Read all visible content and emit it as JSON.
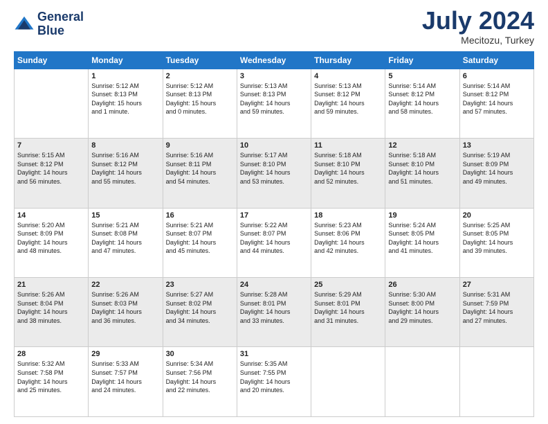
{
  "header": {
    "logo_line1": "General",
    "logo_line2": "Blue",
    "month": "July 2024",
    "location": "Mecitozu, Turkey"
  },
  "weekdays": [
    "Sunday",
    "Monday",
    "Tuesday",
    "Wednesday",
    "Thursday",
    "Friday",
    "Saturday"
  ],
  "weeks": [
    [
      {
        "day": "",
        "info": ""
      },
      {
        "day": "1",
        "info": "Sunrise: 5:12 AM\nSunset: 8:13 PM\nDaylight: 15 hours\nand 1 minute."
      },
      {
        "day": "2",
        "info": "Sunrise: 5:12 AM\nSunset: 8:13 PM\nDaylight: 15 hours\nand 0 minutes."
      },
      {
        "day": "3",
        "info": "Sunrise: 5:13 AM\nSunset: 8:13 PM\nDaylight: 14 hours\nand 59 minutes."
      },
      {
        "day": "4",
        "info": "Sunrise: 5:13 AM\nSunset: 8:12 PM\nDaylight: 14 hours\nand 59 minutes."
      },
      {
        "day": "5",
        "info": "Sunrise: 5:14 AM\nSunset: 8:12 PM\nDaylight: 14 hours\nand 58 minutes."
      },
      {
        "day": "6",
        "info": "Sunrise: 5:14 AM\nSunset: 8:12 PM\nDaylight: 14 hours\nand 57 minutes."
      }
    ],
    [
      {
        "day": "7",
        "info": ""
      },
      {
        "day": "8",
        "info": "Sunrise: 5:16 AM\nSunset: 8:12 PM\nDaylight: 14 hours\nand 55 minutes."
      },
      {
        "day": "9",
        "info": "Sunrise: 5:16 AM\nSunset: 8:11 PM\nDaylight: 14 hours\nand 54 minutes."
      },
      {
        "day": "10",
        "info": "Sunrise: 5:17 AM\nSunset: 8:10 PM\nDaylight: 14 hours\nand 53 minutes."
      },
      {
        "day": "11",
        "info": "Sunrise: 5:18 AM\nSunset: 8:10 PM\nDaylight: 14 hours\nand 52 minutes."
      },
      {
        "day": "12",
        "info": "Sunrise: 5:18 AM\nSunset: 8:10 PM\nDaylight: 14 hours\nand 51 minutes."
      },
      {
        "day": "13",
        "info": "Sunrise: 5:19 AM\nSunset: 8:09 PM\nDaylight: 14 hours\nand 49 minutes."
      }
    ],
    [
      {
        "day": "14",
        "info": ""
      },
      {
        "day": "15",
        "info": "Sunrise: 5:21 AM\nSunset: 8:08 PM\nDaylight: 14 hours\nand 47 minutes."
      },
      {
        "day": "16",
        "info": "Sunrise: 5:21 AM\nSunset: 8:07 PM\nDaylight: 14 hours\nand 45 minutes."
      },
      {
        "day": "17",
        "info": "Sunrise: 5:22 AM\nSunset: 8:07 PM\nDaylight: 14 hours\nand 44 minutes."
      },
      {
        "day": "18",
        "info": "Sunrise: 5:23 AM\nSunset: 8:06 PM\nDaylight: 14 hours\nand 42 minutes."
      },
      {
        "day": "19",
        "info": "Sunrise: 5:24 AM\nSunset: 8:05 PM\nDaylight: 14 hours\nand 41 minutes."
      },
      {
        "day": "20",
        "info": "Sunrise: 5:25 AM\nSunset: 8:05 PM\nDaylight: 14 hours\nand 39 minutes."
      }
    ],
    [
      {
        "day": "21",
        "info": ""
      },
      {
        "day": "22",
        "info": "Sunrise: 5:26 AM\nSunset: 8:03 PM\nDaylight: 14 hours\nand 36 minutes."
      },
      {
        "day": "23",
        "info": "Sunrise: 5:27 AM\nSunset: 8:02 PM\nDaylight: 14 hours\nand 34 minutes."
      },
      {
        "day": "24",
        "info": "Sunrise: 5:28 AM\nSunset: 8:01 PM\nDaylight: 14 hours\nand 33 minutes."
      },
      {
        "day": "25",
        "info": "Sunrise: 5:29 AM\nSunset: 8:01 PM\nDaylight: 14 hours\nand 31 minutes."
      },
      {
        "day": "26",
        "info": "Sunrise: 5:30 AM\nSunset: 8:00 PM\nDaylight: 14 hours\nand 29 minutes."
      },
      {
        "day": "27",
        "info": "Sunrise: 5:31 AM\nSunset: 7:59 PM\nDaylight: 14 hours\nand 27 minutes."
      }
    ],
    [
      {
        "day": "28",
        "info": "Sunrise: 5:32 AM\nSunset: 7:58 PM\nDaylight: 14 hours\nand 25 minutes."
      },
      {
        "day": "29",
        "info": "Sunrise: 5:33 AM\nSunset: 7:57 PM\nDaylight: 14 hours\nand 24 minutes."
      },
      {
        "day": "30",
        "info": "Sunrise: 5:34 AM\nSunset: 7:56 PM\nDaylight: 14 hours\nand 22 minutes."
      },
      {
        "day": "31",
        "info": "Sunrise: 5:35 AM\nSunset: 7:55 PM\nDaylight: 14 hours\nand 20 minutes."
      },
      {
        "day": "",
        "info": ""
      },
      {
        "day": "",
        "info": ""
      },
      {
        "day": "",
        "info": ""
      }
    ]
  ],
  "week1_sunday": "Sunrise: 5:15 AM\nSunset: 8:12 PM\nDaylight: 14 hours\nand 56 minutes.",
  "week2_sunday": "Sunrise: 5:20 AM\nSunset: 8:09 PM\nDaylight: 14 hours\nand 48 minutes.",
  "week3_sunday": "Sunrise: 5:26 AM\nSunset: 8:04 PM\nDaylight: 14 hours\nand 38 minutes."
}
